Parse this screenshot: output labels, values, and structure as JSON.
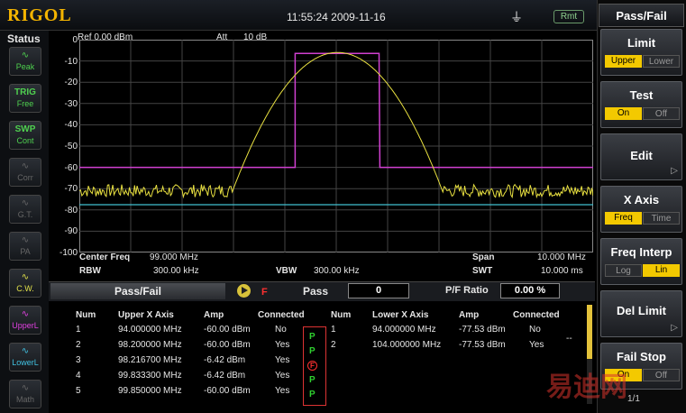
{
  "header": {
    "logo": "RIGOL",
    "time": "11:55:24 2009-11-16",
    "remote": "Rmt"
  },
  "status": {
    "title": "Status",
    "buttons": [
      {
        "top": "",
        "label": "Peak",
        "icon": "peak-icon",
        "color": "#4fd04f"
      },
      {
        "top": "TRIG",
        "label": "Free",
        "icon": "trig-icon",
        "color": "#4fd04f"
      },
      {
        "top": "SWP",
        "label": "Cont",
        "icon": "swp-icon",
        "color": "#4fd04f"
      },
      {
        "top": "",
        "label": "Corr",
        "icon": "corr-icon",
        "color": "#666"
      },
      {
        "top": "",
        "label": "G.T.",
        "icon": "tg-icon",
        "color": "#666"
      },
      {
        "top": "",
        "label": "PA",
        "icon": "pa-icon",
        "color": "#666"
      },
      {
        "top": "",
        "label": "C.W.",
        "icon": "cw-icon",
        "color": "#e0e04a"
      },
      {
        "top": "",
        "label": "UpperL",
        "icon": "upper-limit-icon",
        "color": "#e040e0"
      },
      {
        "top": "",
        "label": "LowerL",
        "icon": "lower-limit-icon",
        "color": "#40c0e0"
      },
      {
        "top": "",
        "label": "Math",
        "icon": "math-icon",
        "color": "#666"
      }
    ]
  },
  "plot": {
    "ref": "Ref 0.00 dBm",
    "att_label": "Att",
    "att_value": "10 dB",
    "y_ticks": [
      "0",
      "-10",
      "-20",
      "-30",
      "-40",
      "-50",
      "-60",
      "-70",
      "-80",
      "-90",
      "-100"
    ],
    "center_freq_label": "Center Freq",
    "center_freq_value": "99.000 MHz",
    "span_label": "Span",
    "span_value": "10.000 MHz",
    "rbw_label": "RBW",
    "rbw_value": "300.00 kHz",
    "vbw_label": "VBW",
    "vbw_value": "300.00 kHz",
    "swt_label": "SWT",
    "swt_value": "10.000 ms"
  },
  "chart_data": {
    "type": "line",
    "ylim": [
      -100,
      0
    ],
    "x_range_mhz": [
      94,
      104
    ],
    "upper_limit_mhz": [
      94.0,
      98.2,
      98.2,
      99.833,
      99.85,
      104.0
    ],
    "upper_limit_dbm": [
      -60,
      -60,
      -6.42,
      -6.42,
      -60,
      -60
    ],
    "lower_limit_dbm": -77.53,
    "trace_peak_dbm": -6,
    "noise_floor_dbm": -71
  },
  "passfail": {
    "title": "Pass/Fail",
    "fail_flag": "F",
    "pass_label": "Pass",
    "pass_value": "0",
    "ratio_label": "P/F Ratio",
    "ratio_value": "0.00 %"
  },
  "table": {
    "upper_headers": [
      "Num",
      "Upper X Axis",
      "Amp",
      "Connected"
    ],
    "lower_headers": [
      "Num",
      "Lower X Axis",
      "Amp",
      "Connected"
    ],
    "upper_rows": [
      [
        "1",
        "94.000000 MHz",
        "-60.00 dBm",
        "No"
      ],
      [
        "2",
        "98.200000 MHz",
        "-60.00 dBm",
        "Yes"
      ],
      [
        "3",
        "98.216700 MHz",
        "-6.42 dBm",
        "Yes"
      ],
      [
        "4",
        "99.833300 MHz",
        "-6.42 dBm",
        "Yes"
      ],
      [
        "5",
        "99.850000 MHz",
        "-60.00 dBm",
        "Yes"
      ]
    ],
    "pf_marks": [
      "P",
      "P",
      "F",
      "P",
      "P"
    ],
    "lower_rows": [
      [
        "1",
        "94.000000 MHz",
        "-77.53 dBm",
        "No"
      ],
      [
        "2",
        "104.000000 MHz",
        "-77.53 dBm",
        "Yes"
      ]
    ],
    "dash": "--"
  },
  "menu": {
    "title": "Pass/Fail",
    "limit": {
      "label": "Limit",
      "opt_a": "Upper",
      "opt_b": "Lower"
    },
    "test": {
      "label": "Test",
      "opt_a": "On",
      "opt_b": "Off"
    },
    "edit": {
      "label": "Edit"
    },
    "xaxis": {
      "label": "X Axis",
      "opt_a": "Freq",
      "opt_b": "Time"
    },
    "interp": {
      "label": "Freq Interp",
      "opt_a": "Log",
      "opt_b": "Lin"
    },
    "del_limit": {
      "label": "Del Limit"
    },
    "fail_stop": {
      "label": "Fail Stop",
      "opt_a": "On",
      "opt_b": "Off"
    },
    "page": "1/1"
  },
  "watermark": "易迪网"
}
